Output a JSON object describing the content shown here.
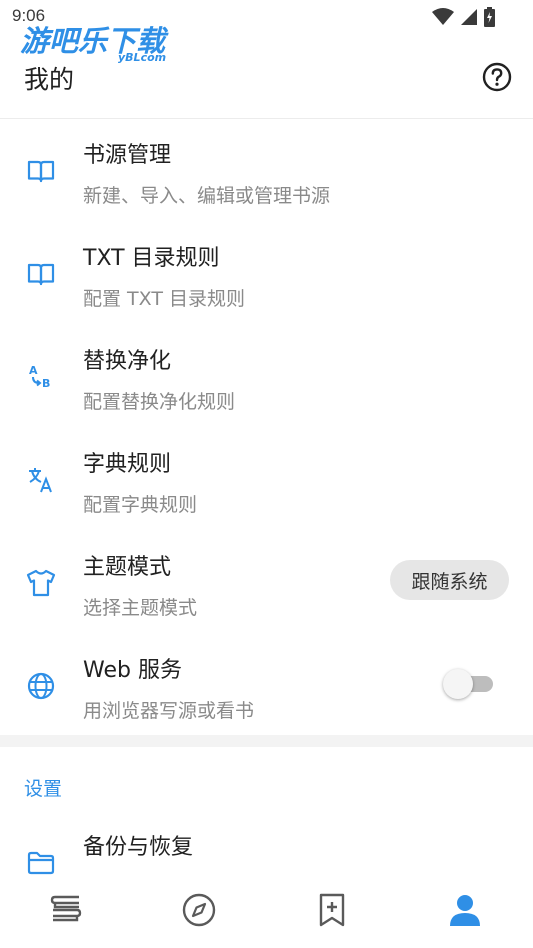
{
  "status_bar": {
    "time": "9:06"
  },
  "watermark": {
    "main": "游吧乐下载",
    "sub": "yBLcom"
  },
  "header": {
    "title": "我的",
    "help_icon": "help-circle-icon"
  },
  "menu": [
    {
      "id": "book-source",
      "icon": "book-open-icon",
      "title": "书源管理",
      "subtitle": "新建、导入、编辑或管理书源"
    },
    {
      "id": "txt-toc",
      "icon": "book-open-icon",
      "title": "TXT 目录规则",
      "subtitle": "配置 TXT 目录规则"
    },
    {
      "id": "replace",
      "icon": "a-to-b-icon",
      "title": "替换净化",
      "subtitle": "配置替换净化规则"
    },
    {
      "id": "dict",
      "icon": "translate-icon",
      "title": "字典规则",
      "subtitle": "配置字典规则"
    },
    {
      "id": "theme",
      "icon": "tshirt-icon",
      "title": "主题模式",
      "subtitle": "选择主题模式",
      "chip": "跟随系统"
    },
    {
      "id": "web",
      "icon": "globe-icon",
      "title": "Web 服务",
      "subtitle": "用浏览器写源或看书",
      "toggle": false
    }
  ],
  "settings_section": {
    "header": "设置",
    "items": [
      {
        "id": "backup",
        "icon": "folder-icon",
        "title": "备份与恢复"
      }
    ]
  },
  "bottom_nav": [
    {
      "id": "bookshelf",
      "icon": "bookshelf-icon",
      "active": false
    },
    {
      "id": "explore",
      "icon": "compass-icon",
      "active": false
    },
    {
      "id": "rss",
      "icon": "bookmark-plus-icon",
      "active": false
    },
    {
      "id": "my",
      "icon": "person-icon",
      "active": true
    }
  ],
  "colors": {
    "accent": "#2f8fe6",
    "inactive_icon": "#5a5a5a",
    "subtitle": "#8a8a8a"
  }
}
